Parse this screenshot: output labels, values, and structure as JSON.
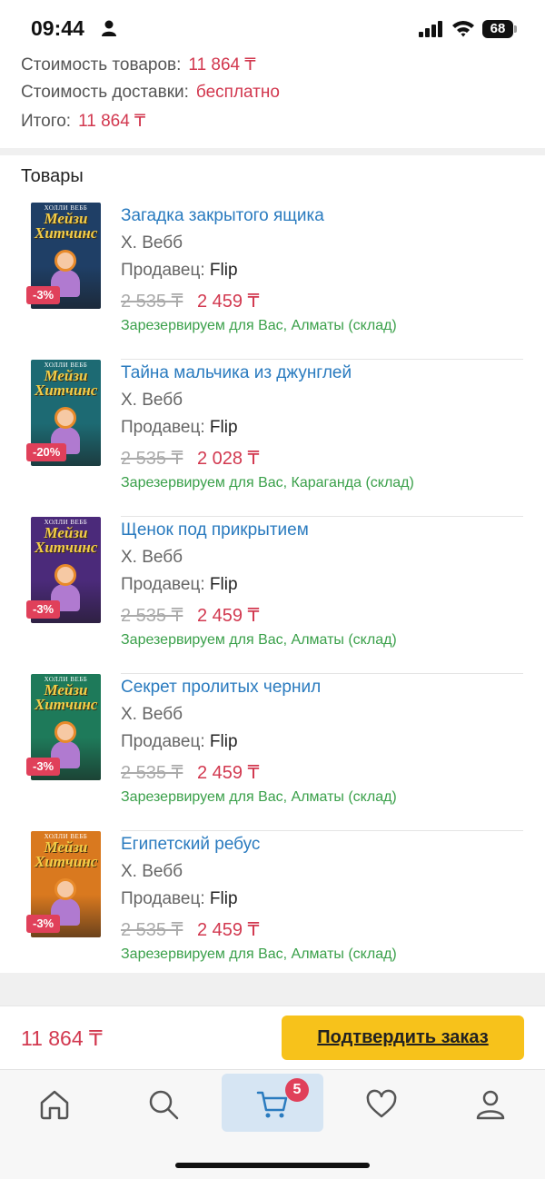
{
  "status_bar": {
    "time": "09:44",
    "battery": "68",
    "icons": [
      "person-icon",
      "signal-icon",
      "wifi-icon",
      "battery-icon"
    ]
  },
  "summary": {
    "goods_label": "Стоимость товаров:",
    "goods_value": "11 864 ₸",
    "delivery_label": "Стоимость доставки:",
    "delivery_value": "бесплатно",
    "total_label": "Итого:",
    "total_value": "11 864 ₸"
  },
  "items_section": {
    "title": "Товары",
    "items": [
      {
        "title": "Загадка закрытого ящика",
        "author": "Х. Вебб",
        "seller_label": "Продавец:",
        "seller": "Flip",
        "old_price": "2 535 ₸",
        "new_price": "2 459 ₸",
        "discount": "-3%",
        "reserve": "Зарезервируем для Вас, Алматы (склад)",
        "cover_color": "#1f3f66",
        "cover_author": "ХОЛЛИ ВЕББ",
        "cover_title": "Мейзи Хитчинс"
      },
      {
        "title": "Тайна мальчика из джунглей",
        "author": "Х. Вебб",
        "seller_label": "Продавец:",
        "seller": "Flip",
        "old_price": "2 535 ₸",
        "new_price": "2 028 ₸",
        "discount": "-20%",
        "reserve": "Зарезервируем для Вас, Караганда (склад)",
        "cover_color": "#1d6a73",
        "cover_author": "ХОЛЛИ ВЕББ",
        "cover_title": "Мейзи Хитчинс"
      },
      {
        "title": "Щенок под прикрытием",
        "author": "Х. Вебб",
        "seller_label": "Продавец:",
        "seller": "Flip",
        "old_price": "2 535 ₸",
        "new_price": "2 459 ₸",
        "discount": "-3%",
        "reserve": "Зарезервируем для Вас, Алматы (склад)",
        "cover_color": "#4b2a7a",
        "cover_author": "ХОЛЛИ ВЕББ",
        "cover_title": "Мейзи Хитчинс"
      },
      {
        "title": "Секрет пролитых чернил",
        "author": "Х. Вебб",
        "seller_label": "Продавец:",
        "seller": "Flip",
        "old_price": "2 535 ₸",
        "new_price": "2 459 ₸",
        "discount": "-3%",
        "reserve": "Зарезервируем для Вас, Алматы (склад)",
        "cover_color": "#1e7a5a",
        "cover_author": "ХОЛЛИ ВЕББ",
        "cover_title": "Мейзи Хитчинс"
      },
      {
        "title": "Египетский ребус",
        "author": "Х. Вебб",
        "seller_label": "Продавец:",
        "seller": "Flip",
        "old_price": "2 535 ₸",
        "new_price": "2 459 ₸",
        "discount": "-3%",
        "reserve": "Зарезервируем для Вас, Алматы (склад)",
        "cover_color": "#d9791f",
        "cover_author": "ХОЛЛИ ВЕББ",
        "cover_title": "Мейзи Хитчинс"
      }
    ]
  },
  "order_bar": {
    "total": "11 864 ₸",
    "confirm_label": "Подтвердить заказ"
  },
  "tab_bar": {
    "tabs": [
      "home-icon",
      "search-icon",
      "cart-icon",
      "heart-icon",
      "profile-icon"
    ],
    "active": "cart-icon",
    "cart_count": "5",
    "accent": "#d6e5f3"
  },
  "colors": {
    "price": "#d2384f",
    "link": "#2a7bbf",
    "reserve": "#3aa04a",
    "button": "#f7c21b",
    "badge": "#e0405a"
  }
}
